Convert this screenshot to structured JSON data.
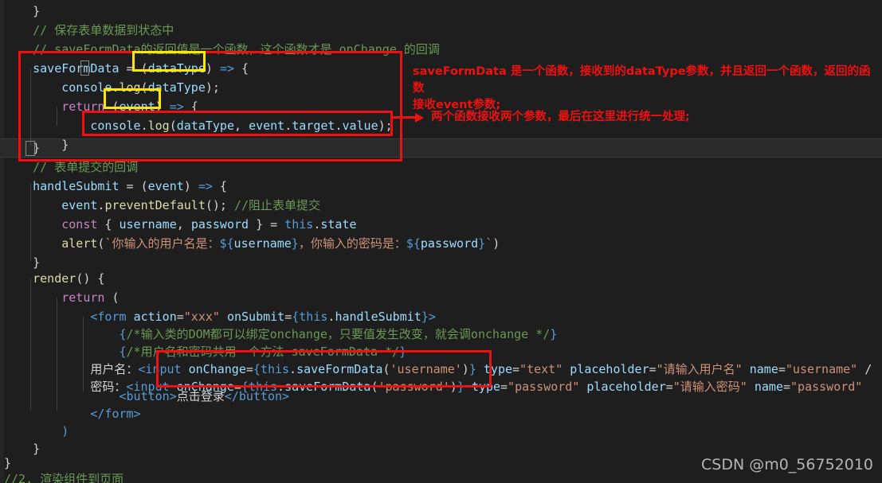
{
  "editor": {
    "theme_background": "#1e1e1e",
    "current_line_background": "#2a2a2a",
    "font_size_px": 15,
    "colors": {
      "comment": "#6A9955",
      "variable": "#9CDCFE",
      "keyword": "#C586C0",
      "tag": "#569CD6",
      "function": "#DCDCAA",
      "string": "#CE9178",
      "plain": "#D4D4D4",
      "annotation_red": "#EE1111",
      "highlight_yellow": "#FFE800"
    }
  },
  "code_lines": [
    {
      "id": "l01",
      "text": "    }"
    },
    {
      "id": "l02",
      "text": "    // 保存表单数据到状态中"
    },
    {
      "id": "l03",
      "text": "    // saveFormData的返回值是一个函数，这个函数才是 onChange 的回调"
    },
    {
      "id": "l04",
      "text": "    saveFormData = (dataType) => {"
    },
    {
      "id": "l05",
      "text": "        console.log(dataType);"
    },
    {
      "id": "l06",
      "text": "        return (event) => {"
    },
    {
      "id": "l07",
      "text": "            console.log(dataType, event.target.value);"
    },
    {
      "id": "l08",
      "text": "        }"
    },
    {
      "id": "l09",
      "text": "    }"
    },
    {
      "id": "l10",
      "text": "    // 表单提交的回调"
    },
    {
      "id": "l11",
      "text": "    handleSubmit = (event) => {"
    },
    {
      "id": "l12",
      "text": "        event.preventDefault(); //阻止表单提交"
    },
    {
      "id": "l13",
      "text": "        const { username, password } = this.state"
    },
    {
      "id": "l14",
      "text": "        alert(`你输入的用户名是：${username}，你输入的密码是：${password}`)"
    },
    {
      "id": "l15",
      "text": "    }"
    },
    {
      "id": "l16",
      "text": "    render() {"
    },
    {
      "id": "l17",
      "text": "        return ("
    },
    {
      "id": "l18",
      "text": "            <form action=\"xxx\" onSubmit={this.handleSubmit}>"
    },
    {
      "id": "l19",
      "text": "                {/*输入类的DOM都可以绑定onchange，只要值发生改变，就会调onchange */}"
    },
    {
      "id": "l20",
      "text": "                {/*用户名和密码共用一个方法 saveFormData */}"
    },
    {
      "id": "l21",
      "text": "                用户名：<input onChange={this.saveFormData('username')} type=\"text\" placeholder=\"请输入用户名\" name=\"username\" /"
    },
    {
      "id": "l22",
      "text": "                密码：<input onChange={this.saveFormData('password')} type=\"password\" placeholder=\"请输入密码\" name=\"password\""
    },
    {
      "id": "l23",
      "text": "                <button>点击登录</button>"
    },
    {
      "id": "l24",
      "text": "            </form>"
    },
    {
      "id": "l25",
      "text": "        )"
    },
    {
      "id": "l26",
      "text": "    }"
    },
    {
      "id": "l27",
      "text": "}"
    },
    {
      "id": "l28",
      "text": "//2. 渲染组件到页面"
    }
  ],
  "annotations": {
    "note_1": "saveFormData 是一个函数，接收到的dataType参数，并且返回一个函数，返回的函数\n接收event参数;",
    "note_2": "两个函数接收两个参数，最后在这里进行统一处理;",
    "highlight_boxes": [
      {
        "id": "outer-red-box",
        "target": "saveFormData function body"
      },
      {
        "id": "inner-red-box",
        "target": "console.log(dataType, event.target.value);"
      },
      {
        "id": "input-red-box",
        "target": "input onChange handlers"
      },
      {
        "id": "yellow-box-datatype",
        "target": "(dataType)"
      },
      {
        "id": "yellow-box-event",
        "target": "(event)"
      }
    ]
  },
  "watermark": {
    "text": "CSDN @m0_56752010"
  }
}
